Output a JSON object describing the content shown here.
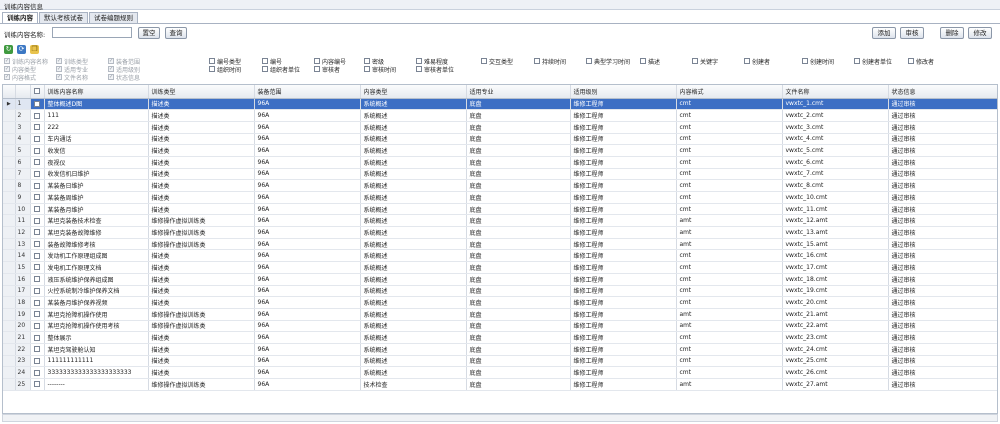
{
  "window": {
    "title": "训练内容信息"
  },
  "tabs": [
    "训练内容",
    "默认考核试卷",
    "试卷编题规则"
  ],
  "search": {
    "label": "训练内容名称:",
    "value": "",
    "placeholder": ""
  },
  "buttons": {
    "clear": "置空",
    "query": "查询",
    "add": "添加",
    "review": "审核",
    "delete": "删除",
    "edit": "修改"
  },
  "icons": [
    "refresh-icon",
    "sync-icon",
    "copy-icon"
  ],
  "column_options": [
    {
      "label": "训练内容名称",
      "checked": true,
      "disabled": true
    },
    {
      "label": "训练类型",
      "checked": true,
      "disabled": true
    },
    {
      "label": "装备范围",
      "checked": true,
      "disabled": true
    },
    {
      "label": "内容类型",
      "checked": true,
      "disabled": true
    },
    {
      "label": "适用专业",
      "checked": true,
      "disabled": true
    },
    {
      "label": "适用级别",
      "checked": true,
      "disabled": true
    },
    {
      "label": "内容格式",
      "checked": true,
      "disabled": true
    },
    {
      "label": "文件名称",
      "checked": true,
      "disabled": true
    },
    {
      "label": "状态信息",
      "checked": true,
      "disabled": true
    },
    {
      "label": "编号类型",
      "checked": false,
      "disabled": false
    },
    {
      "label": "组织时间",
      "checked": false,
      "disabled": false
    },
    {
      "label": "编号",
      "checked": false,
      "disabled": false
    },
    {
      "label": "组织者单位",
      "checked": false,
      "disabled": false
    },
    {
      "label": "内容编号",
      "checked": false,
      "disabled": false
    },
    {
      "label": "审核者",
      "checked": false,
      "disabled": false
    },
    {
      "label": "密级",
      "checked": false,
      "disabled": false
    },
    {
      "label": "审核时间",
      "checked": false,
      "disabled": false
    },
    {
      "label": "难易程度",
      "checked": false,
      "disabled": false
    },
    {
      "label": "审核者单位",
      "checked": false,
      "disabled": false
    },
    {
      "label": "交互类型",
      "checked": false,
      "disabled": false
    },
    {
      "label": "持续时间",
      "checked": false,
      "disabled": false
    },
    {
      "label": "典型学习时间",
      "checked": false,
      "disabled": false
    },
    {
      "label": "描述",
      "checked": false,
      "disabled": false
    },
    {
      "label": "关键字",
      "checked": false,
      "disabled": false
    },
    {
      "label": "创建者",
      "checked": false,
      "disabled": false
    },
    {
      "label": "创建时间",
      "checked": false,
      "disabled": false
    },
    {
      "label": "创建者单位",
      "checked": false,
      "disabled": false
    },
    {
      "label": "修改者",
      "checked": false,
      "disabled": false
    }
  ],
  "table": {
    "columns": [
      "训练内容名称",
      "训练类型",
      "装备范围",
      "内容类型",
      "适用专业",
      "适用级别",
      "内容格式",
      "文件名称",
      "状态信息"
    ],
    "selected_row": 1,
    "rows": [
      [
        "整体概述D图",
        "描述类",
        "96A",
        "系统概述",
        "底盘",
        "维修工程师",
        "cmt",
        "vwxtc_1.cmt",
        "通过审核"
      ],
      [
        "111",
        "描述类",
        "96A",
        "系统概述",
        "底盘",
        "维修工程师",
        "cmt",
        "vwxtc_2.cmt",
        "通过审核"
      ],
      [
        "222",
        "描述类",
        "96A",
        "系统概述",
        "底盘",
        "维修工程师",
        "cmt",
        "vwxtc_3.cmt",
        "通过审核"
      ],
      [
        "车内通话",
        "描述类",
        "96A",
        "系统概述",
        "底盘",
        "维修工程师",
        "cmt",
        "vwxtc_4.cmt",
        "通过审核"
      ],
      [
        "收发信",
        "描述类",
        "96A",
        "系统概述",
        "底盘",
        "维修工程师",
        "cmt",
        "vwxtc_5.cmt",
        "通过审核"
      ],
      [
        "夜视仪",
        "描述类",
        "96A",
        "系统概述",
        "底盘",
        "维修工程师",
        "cmt",
        "vwxtc_6.cmt",
        "通过审核"
      ],
      [
        "收发信机日维护",
        "描述类",
        "96A",
        "系统概述",
        "底盘",
        "维修工程师",
        "cmt",
        "vwxtc_7.cmt",
        "通过审核"
      ],
      [
        "某装备日维护",
        "描述类",
        "96A",
        "系统概述",
        "底盘",
        "维修工程师",
        "cmt",
        "vwxtc_8.cmt",
        "通过审核"
      ],
      [
        "某装备周维护",
        "描述类",
        "96A",
        "系统概述",
        "底盘",
        "维修工程师",
        "cmt",
        "vwxtc_10.cmt",
        "通过审核"
      ],
      [
        "某装备月维护",
        "描述类",
        "96A",
        "系统概述",
        "底盘",
        "维修工程师",
        "cmt",
        "vwxtc_11.cmt",
        "通过审核"
      ],
      [
        "某坦克装备技术检查",
        "维修操作虚拟训练类",
        "96A",
        "系统概述",
        "底盘",
        "维修工程师",
        "amt",
        "vwxtc_12.amt",
        "通过审核"
      ],
      [
        "某坦克装备故障维修",
        "维修操作虚拟训练类",
        "96A",
        "系统概述",
        "底盘",
        "维修工程师",
        "amt",
        "vwxtc_13.amt",
        "通过审核"
      ],
      [
        "装备故障维修考核",
        "维修操作虚拟训练类",
        "96A",
        "系统概述",
        "底盘",
        "维修工程师",
        "amt",
        "vwxtc_15.amt",
        "通过审核"
      ],
      [
        "发动机工作原理组成图",
        "描述类",
        "96A",
        "系统概述",
        "底盘",
        "维修工程师",
        "cmt",
        "vwxtc_16.cmt",
        "通过审核"
      ],
      [
        "发电机工作原理文档",
        "描述类",
        "96A",
        "系统概述",
        "底盘",
        "维修工程师",
        "cmt",
        "vwxtc_17.cmt",
        "通过审核"
      ],
      [
        "液压系统维护保养组成图",
        "描述类",
        "96A",
        "系统概述",
        "底盘",
        "维修工程师",
        "cmt",
        "vwxtc_18.cmt",
        "通过审核"
      ],
      [
        "火控系统制冷维护保养文档",
        "描述类",
        "96A",
        "系统概述",
        "底盘",
        "维修工程师",
        "cmt",
        "vwxtc_19.cmt",
        "通过审核"
      ],
      [
        "某装备月维护保养视频",
        "描述类",
        "96A",
        "系统概述",
        "底盘",
        "维修工程师",
        "cmt",
        "vwxtc_20.cmt",
        "通过审核"
      ],
      [
        "某坦克抢障机操作使用",
        "维修操作虚拟训练类",
        "96A",
        "系统概述",
        "底盘",
        "维修工程师",
        "amt",
        "vwxtc_21.amt",
        "通过审核"
      ],
      [
        "某坦克抢障机操作使用考核",
        "维修操作虚拟训练类",
        "96A",
        "系统概述",
        "底盘",
        "维修工程师",
        "amt",
        "vwxtc_22.amt",
        "通过审核"
      ],
      [
        "整体展示",
        "描述类",
        "96A",
        "系统概述",
        "底盘",
        "维修工程师",
        "cmt",
        "vwxtc_23.cmt",
        "通过审核"
      ],
      [
        "某坦克驾驶舱认知",
        "描述类",
        "96A",
        "系统概述",
        "底盘",
        "维修工程师",
        "cmt",
        "vwxtc_24.cmt",
        "通过审核"
      ],
      [
        "111111111111",
        "描述类",
        "96A",
        "系统概述",
        "底盘",
        "维修工程师",
        "cmt",
        "vwxtc_25.cmt",
        "通过审核"
      ],
      [
        "3333333333333333333333",
        "描述类",
        "96A",
        "系统概述",
        "底盘",
        "维修工程师",
        "cmt",
        "vwxtc_26.cmt",
        "通过审核"
      ],
      [
        "--------",
        "维修操作虚拟训练类",
        "96A",
        "技术检查",
        "底盘",
        "维修工程师",
        "amt",
        "vwxtc_27.amt",
        "通过审核"
      ]
    ]
  },
  "colors": {
    "selected_row": "#3d6fc4",
    "header_bg": "#e6eaf0",
    "tab_border": "#a8b2c2"
  }
}
